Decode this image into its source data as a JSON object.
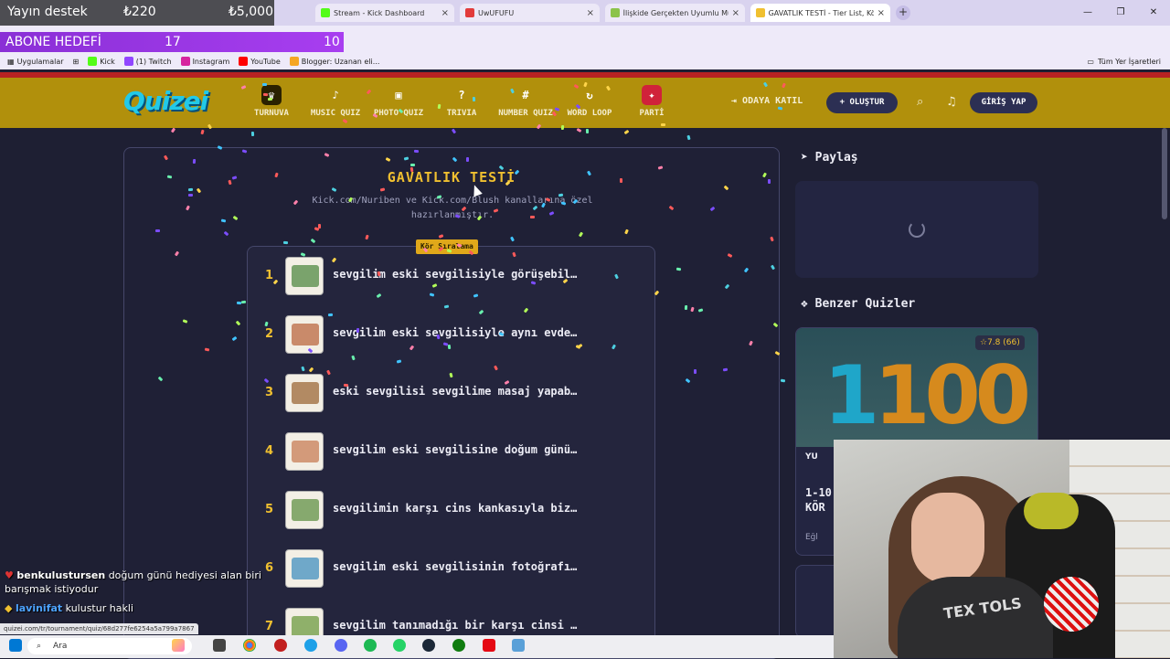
{
  "browser": {
    "tabs": [
      {
        "label": "Stream - Kick Dashboard",
        "favicon_color": "#53fc18"
      },
      {
        "label": "UwUFUFU",
        "favicon_color": "#e23b3b"
      },
      {
        "label": "İlişkide Gerçekten Uyumlu Mu",
        "favicon_color": "#8bc34a"
      },
      {
        "label": "GAVATLIK TESTİ - Tier List, Kör",
        "favicon_color": "#f0c030"
      }
    ],
    "bookmarks": [
      "Uygulamalar",
      "Kick",
      "(1) Twitch",
      "Instagram",
      "YouTube",
      "Blogger: Uzanan eli..."
    ],
    "all_bookmarks": "Tüm Yer İşaretleri",
    "status_url": "quizei.com/tr/tournament/quiz/68d277fe6254a5a799a7867"
  },
  "overlay": {
    "donation_label": "Yayın destek",
    "donation_current": "₺220",
    "donation_goal": "₺5,000",
    "sub_goal_label": "ABONE HEDEFİ",
    "sub_goal_current": "17",
    "sub_goal_target": "10"
  },
  "nav": {
    "logo": "Quizei",
    "items": [
      "TURNUVA",
      "MUSIC QUIZ",
      "PHOTO QUIZ",
      "TRIVIA",
      "NUMBER QUIZ",
      "WORD LOOP",
      "PARTİ"
    ],
    "join_label": "ODAYA KATIL",
    "create_label": "+ OLUŞTUR",
    "login_label": "GİRİŞ YAP"
  },
  "quiz": {
    "title": "GAVATLIK TESTİ",
    "description": "Kick.com/Nuriben ve Kick.com/Blush kanallarına özel hazırlanmıştır.",
    "mode_badge": "Kör Sıralama",
    "items": [
      {
        "num": "1",
        "text": "sevgilim eski sevgilisiyle görüşebil…",
        "color": "#7aa36c"
      },
      {
        "num": "2",
        "text": "sevgilim eski sevgilisiyle aynı evde…",
        "color": "#c98a6a"
      },
      {
        "num": "3",
        "text": "eski sevgilisi sevgilime masaj yapab…",
        "color": "#b28a63"
      },
      {
        "num": "4",
        "text": "sevgilim eski sevgilisine doğum günü…",
        "color": "#d39a7a"
      },
      {
        "num": "5",
        "text": "sevgilimin karşı cins kankasıyla biz…",
        "color": "#86a96e"
      },
      {
        "num": "6",
        "text": "sevgilim eski sevgilisinin fotoğrafı…",
        "color": "#6fa8c9"
      },
      {
        "num": "7",
        "text": "sevgilim tanımadığı bir karşı cinsi …",
        "color": "#8fb06a"
      }
    ]
  },
  "sidebar": {
    "share_title": "Paylaş",
    "similar_title": "Benzer Quizler",
    "similar": {
      "rating": "☆7.8 (66)",
      "image_text_one": "1",
      "image_text_rest": "100",
      "user": "YU",
      "name": "1-10\nKÖR",
      "category": "Eğl"
    }
  },
  "chat": {
    "messages": [
      {
        "user": "benkulustursen",
        "text": "doğum günü hediyesi alan biri barışmak istiyodur"
      },
      {
        "user": "lavinifat",
        "text": "kulustur hakli"
      }
    ]
  },
  "taskbar": {
    "search_label": "Ara"
  },
  "stream": {
    "shirt_text": "TEX TOLS"
  }
}
